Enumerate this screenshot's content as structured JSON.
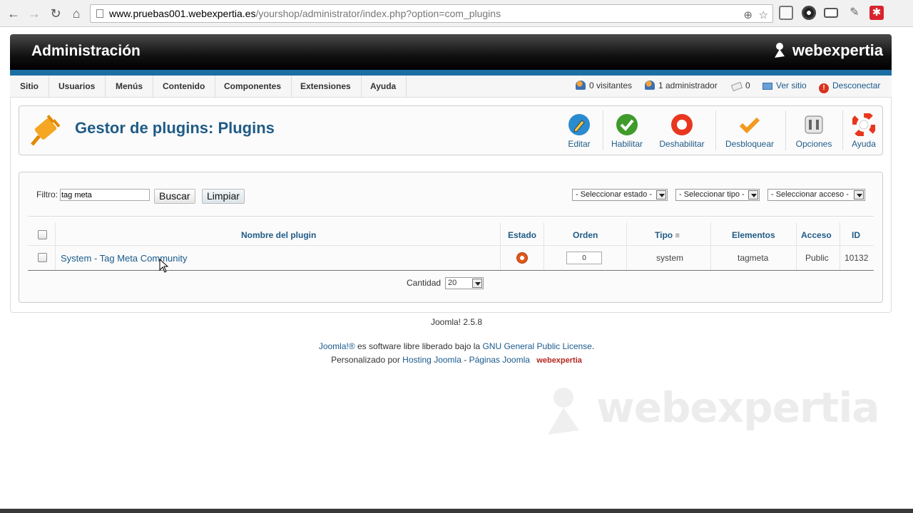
{
  "browser": {
    "url_host": "www.pruebas001.webexpertia.es",
    "url_path": "/yourshop/administrator/index.php?option=com_plugins"
  },
  "header": {
    "title": "Administración",
    "brand": "webexpertia"
  },
  "menu": {
    "items": [
      "Sitio",
      "Usuarios",
      "Menús",
      "Contenido",
      "Componentes",
      "Extensiones",
      "Ayuda"
    ]
  },
  "status": {
    "visitors": "0 visitantes",
    "admins": "1 administrador",
    "messages": "0",
    "view_site": "Ver sitio",
    "logout": "Desconectar"
  },
  "toolbar": {
    "page_title": "Gestor de plugins: Plugins",
    "buttons": {
      "edit": "Editar",
      "enable": "Habilitar",
      "disable": "Deshabilitar",
      "checkin": "Desbloquear",
      "options": "Opciones",
      "help": "Ayuda"
    }
  },
  "filter": {
    "label": "Filtro:",
    "value": "tag meta",
    "search_button": "Buscar",
    "clear_button": "Limpiar",
    "state_select": "- Seleccionar estado -",
    "type_select": "- Seleccionar tipo -",
    "access_select": "- Seleccionar acceso -"
  },
  "table": {
    "headers": {
      "name": "Nombre del plugin",
      "state": "Estado",
      "order": "Orden",
      "type": "Tipo",
      "elements": "Elementos",
      "access": "Acceso",
      "id": "ID"
    },
    "rows": [
      {
        "name": "System - Tag Meta Community",
        "order": "0",
        "type": "system",
        "element": "tagmeta",
        "access": "Public",
        "id": "10132"
      }
    ]
  },
  "pagination": {
    "label": "Cantidad",
    "value": "20"
  },
  "footer": {
    "version": "Joomla! 2.5.8",
    "joomla_link": "Joomla!®",
    "license_text": " es software libre liberado bajo la ",
    "license_link": "GNU General Public License",
    "license_end": ".",
    "customized_by": "Personalizado por ",
    "hosting_link": "Hosting Joomla",
    "dash": " - ",
    "pages_link": "Páginas Joomla",
    "brand": "webexpertia"
  },
  "watermark": "webexpertia",
  "colors": {
    "accent_blue": "#1f5b86",
    "header_strip": "#1b6fa3",
    "state_enabled": "#e05a1a"
  }
}
